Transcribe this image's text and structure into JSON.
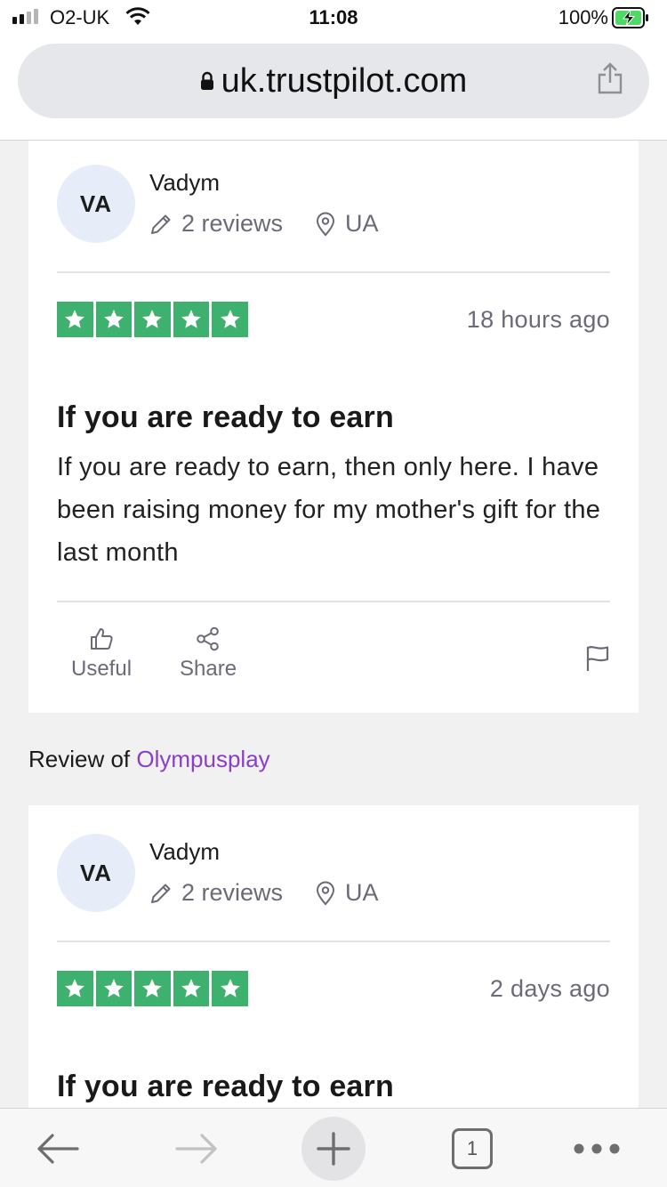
{
  "status_bar": {
    "carrier": "O2-UK",
    "time": "11:08",
    "battery": "100%"
  },
  "browser": {
    "url": "uk.trustpilot.com",
    "open_tabs": "1"
  },
  "reviews": [
    {
      "initials": "VA",
      "reviewer": "Vadym",
      "review_count": "2 reviews",
      "country": "UA",
      "rating": 5,
      "date": "18 hours ago",
      "title": "If you are ready to earn",
      "body": "If you are ready to earn, then only here. I have been raising money for my mother's gift for the last month",
      "useful_label": "Useful",
      "share_label": "Share"
    },
    {
      "initials": "VA",
      "reviewer": "Vadym",
      "review_count": "2 reviews",
      "country": "UA",
      "rating": 5,
      "date": "2 days ago",
      "title": "If you are ready to earn"
    }
  ],
  "review_of": {
    "prefix": "Review of",
    "company": "Olympusplay"
  },
  "colors": {
    "star_green": "#3fb16e",
    "company_link": "#8a3fc6",
    "avatar_bg": "#e6edf8"
  }
}
